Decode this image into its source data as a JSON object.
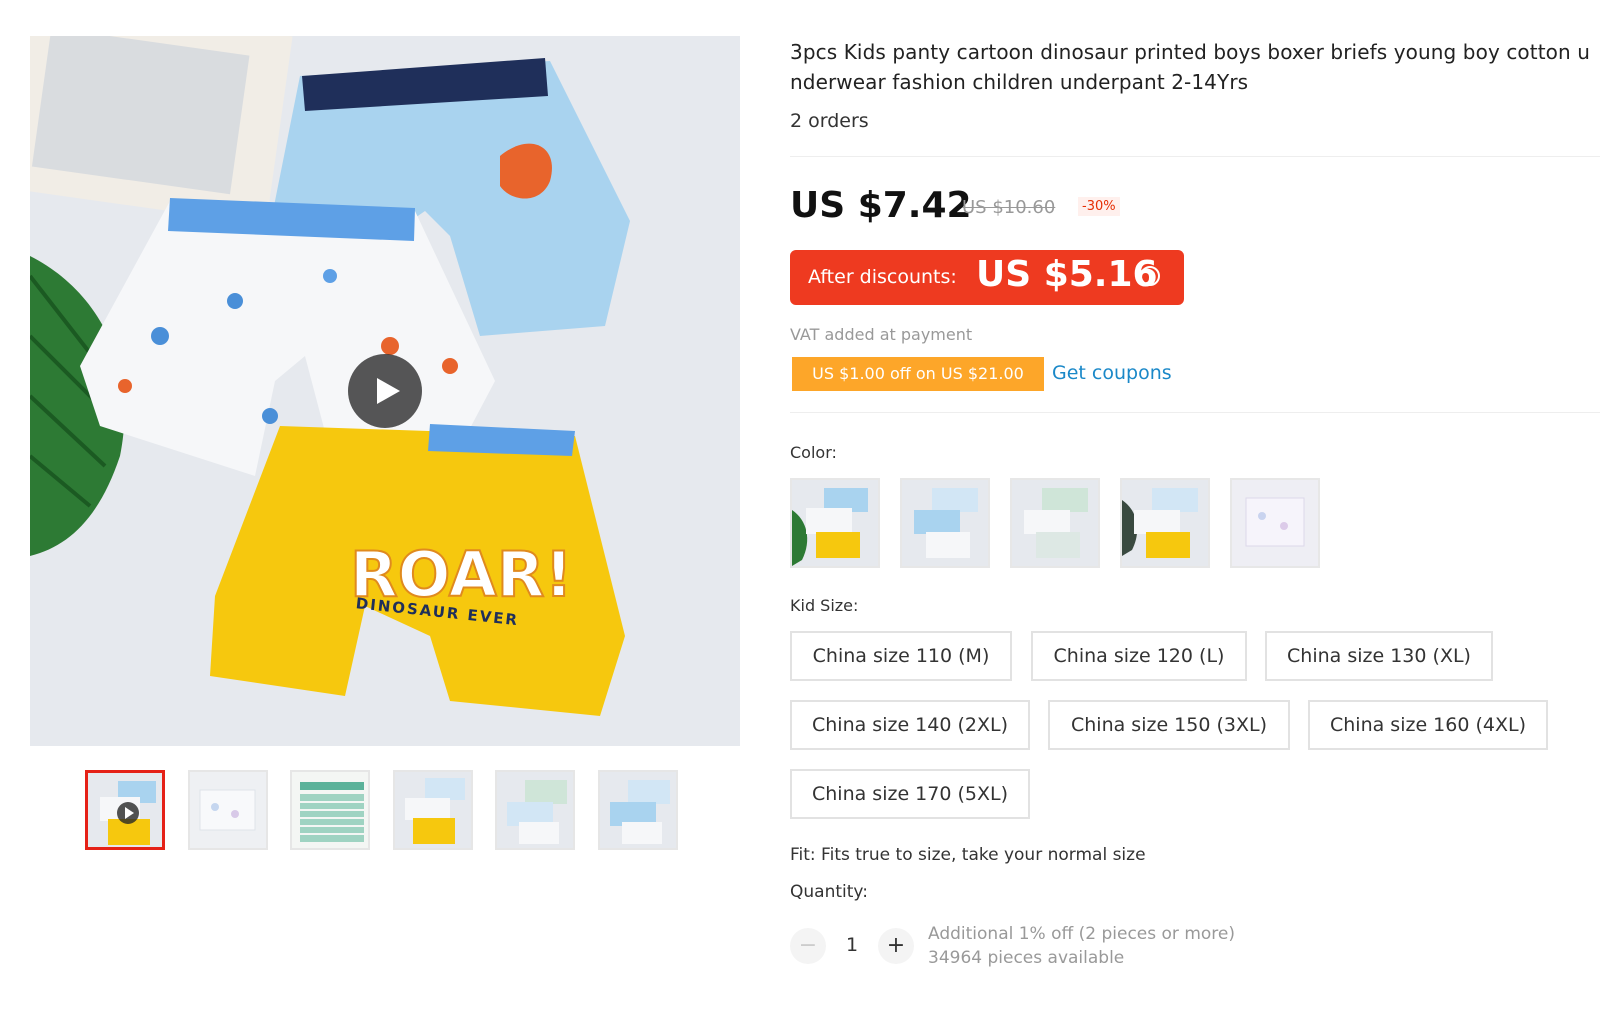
{
  "product": {
    "title": "3pcs Kids panty cartoon dinosaur printed boys boxer briefs young boy cotton underwear fashion children underpant 2-14Yrs",
    "orders": "2 orders"
  },
  "pricing": {
    "price": "US $7.42",
    "original_price": "US $10.60",
    "discount": "-30%",
    "after_discounts_label": "After discounts:",
    "after_discounts_amount": "US $5.16",
    "help_symbol": "?",
    "vat_note": "VAT added at payment",
    "coupon_badge": "US $1.00 off on US $21.00",
    "get_coupons": "Get coupons"
  },
  "color": {
    "label": "Color:",
    "swatch_count": 5
  },
  "kid_size": {
    "label": "Kid Size:",
    "options": [
      "China size 110 (M)",
      "China size 120 (L)",
      "China size 130 (XL)",
      "China size 140 (2XL)",
      "China size 150 (3XL)",
      "China size 160 (4XL)",
      "China size 170 (5XL)"
    ]
  },
  "fit": "Fit: Fits true to size, take your normal size",
  "quantity": {
    "label": "Quantity:",
    "minus": "−",
    "plus": "+",
    "value": "1",
    "note_1": "Additional 1% off (2 pieces or more)",
    "note_2": "34964 pieces available"
  },
  "main_image": {
    "roar_text": "ROAR!",
    "sub_text": "DINOSAUR EVER"
  },
  "colors_theme": {
    "accent_red": "#ee3a20",
    "coupon_orange": "#fda629",
    "link_blue": "#1a88c8",
    "yellow": "#f6c80e",
    "light_blue": "#a9d3ef"
  }
}
